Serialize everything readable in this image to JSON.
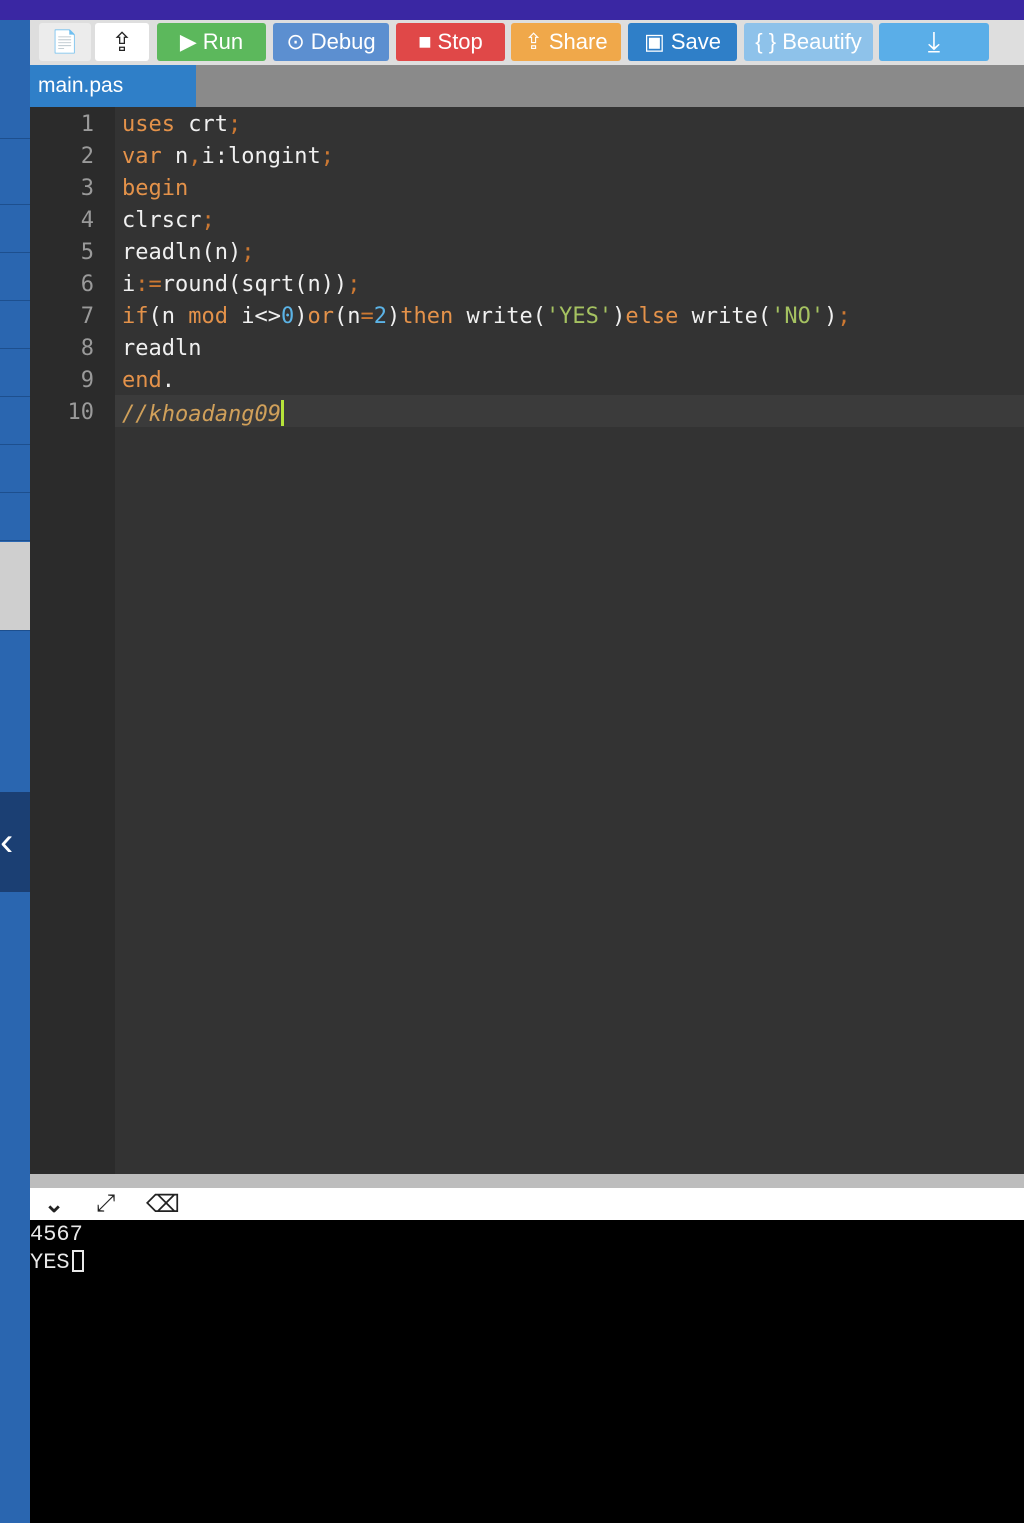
{
  "toolbar": {
    "new_file": "📄",
    "upload": "⇪",
    "run": "Run",
    "debug": "Debug",
    "stop": "Stop",
    "share": "Share",
    "save": "Save",
    "beautify": "{ } Beautify",
    "download": "⤓"
  },
  "tab": {
    "name": "main.pas"
  },
  "editor": {
    "line_numbers": [
      "1",
      "2",
      "3",
      "4",
      "5",
      "6",
      "7",
      "8",
      "9",
      "10"
    ],
    "comment": "//khoadang09"
  },
  "console": {
    "lines": [
      "4567",
      "YES"
    ]
  },
  "colors": {
    "run": "#5cb85c",
    "debug": "#5c8fd0",
    "stop": "#e04848",
    "share": "#f0a84a",
    "save": "#2f7fc8",
    "beautify": "#8ec2ea",
    "download": "#5aaee8"
  }
}
